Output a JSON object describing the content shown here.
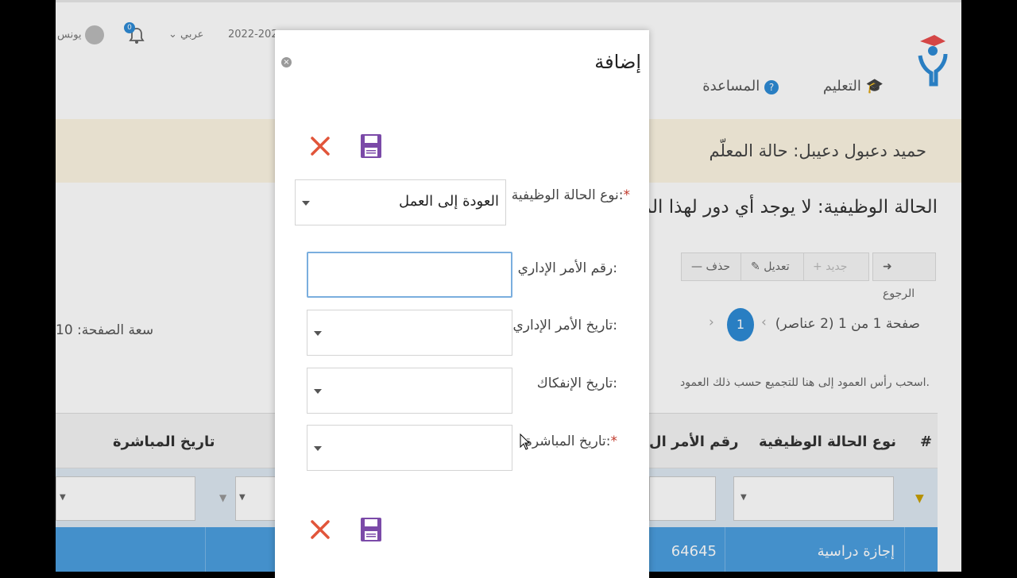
{
  "header": {
    "user_name": "يونس",
    "notification_count": "0",
    "language": "عربي",
    "year": "2022-202"
  },
  "nav": {
    "education": "التعليم",
    "help": "المساعدة"
  },
  "page": {
    "teacher_status_title": "حميد دعبول دعيبل: حالة المعلّم",
    "job_status_line": "الحالة الوظيفية: لا يوجد أي دور لهذا المعلّ",
    "toolbar": {
      "back": "الرجوع",
      "new": "جديد",
      "edit": "تعديل",
      "delete": "حذف"
    },
    "pager_text": "صفحة 1 من 1 (2 عناصر)",
    "pager_current": "1",
    "page_size_label": "سعة الصفحة: 10",
    "group_hint": "اسحب رأس العمود إلى هنا للتجميع حسب ذلك العمود.",
    "grid": {
      "columns": [
        "#",
        "نوع الحالة الوظيفية",
        "رقم الأمر ال",
        "تاريخ المباشرة"
      ],
      "rows": [
        {
          "type": "إجازة دراسية",
          "order_number": "64645"
        }
      ]
    }
  },
  "modal": {
    "title": "إضافة",
    "fields": {
      "status_type_label": "نوع الحالة الوظيفية:",
      "status_type_value": "العودة إلى العمل",
      "order_number_label": "رقم الأمر الإداري:",
      "order_number_value": "",
      "order_date_label": "تاريخ الأمر الإداري:",
      "separation_date_label": "تاريخ الإنفكاك:",
      "start_date_label": "تاريخ المباشرة:"
    },
    "required_mark": "*"
  },
  "colors": {
    "accent": "#2e8bd6",
    "cancel": "#e1553a",
    "save": "#7b4aa8"
  }
}
